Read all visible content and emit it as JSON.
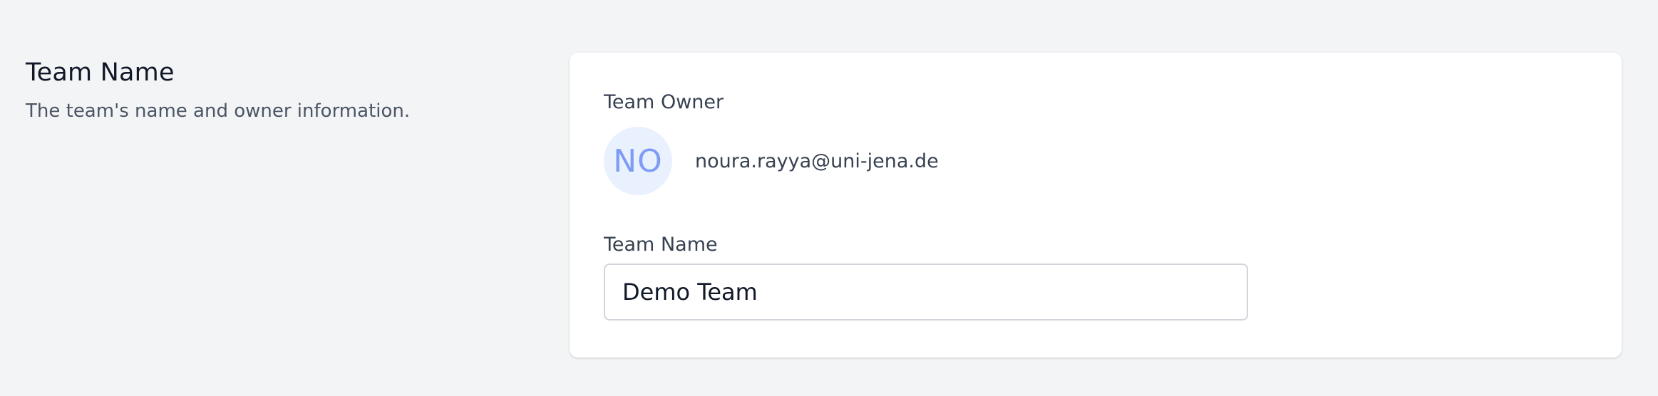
{
  "section": {
    "title": "Team Name",
    "description": "The team's name and owner information."
  },
  "card": {
    "owner_label": "Team Owner",
    "owner": {
      "initials": "NO",
      "email": "noura.rayya@uni-jena.de"
    },
    "name_label": "Team Name",
    "name_value": "Demo Team"
  },
  "colors": {
    "page_bg": "#f3f4f6",
    "card_bg": "#ffffff",
    "avatar_bg": "#e8f1fd",
    "avatar_text": "#7f9cf5"
  }
}
